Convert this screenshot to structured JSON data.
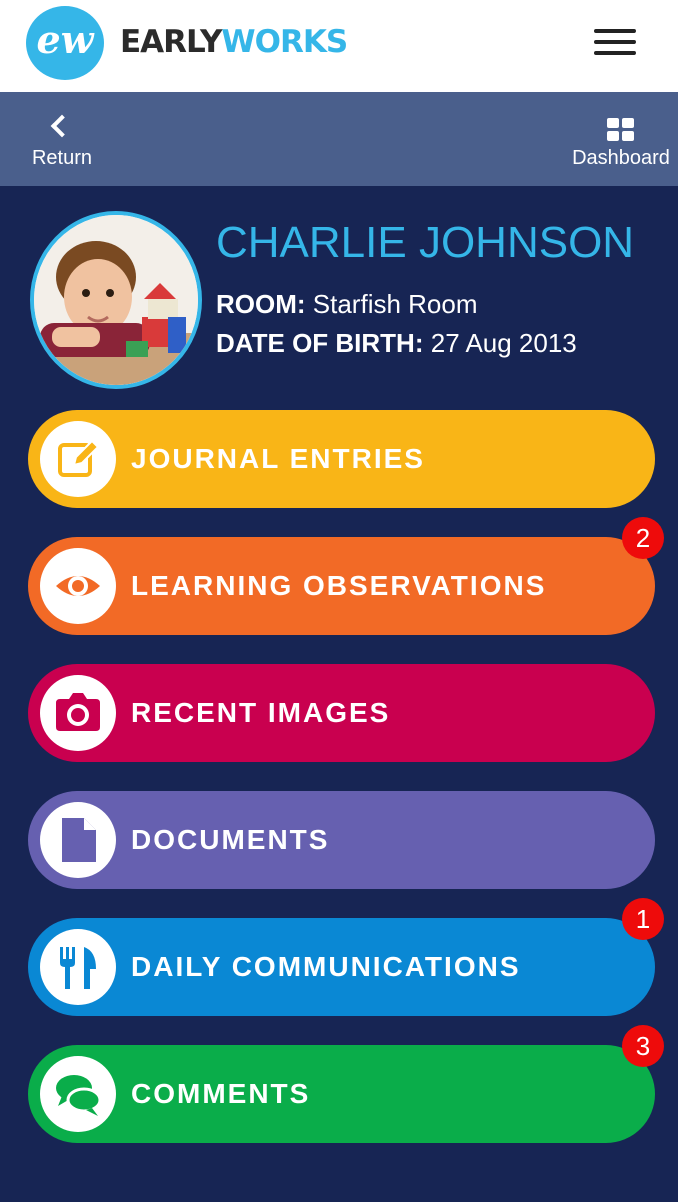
{
  "app": {
    "logo_monogram": "ew",
    "brand_part1": "EARLY",
    "brand_part2": "WORKS"
  },
  "nav": {
    "return_label": "Return",
    "dashboard_label": "Dashboard"
  },
  "child": {
    "name": "CHARLIE JOHNSON",
    "room_key": "ROOM:",
    "room_value": "Starfish Room",
    "dob_key": "DATE OF BIRTH:",
    "dob_value": "27 Aug 2013"
  },
  "menu": [
    {
      "label": "JOURNAL ENTRIES",
      "icon": "edit-icon",
      "color": "#f9b517",
      "badge": ""
    },
    {
      "label": "LEARNING OBSERVATIONS",
      "icon": "eye-icon",
      "color": "#f26a26",
      "badge": "2"
    },
    {
      "label": "RECENT IMAGES",
      "icon": "camera-icon",
      "color": "#c9004f",
      "badge": ""
    },
    {
      "label": "DOCUMENTS",
      "icon": "document-icon",
      "color": "#6660b0",
      "badge": ""
    },
    {
      "label": "DAILY COMMUNICATIONS",
      "icon": "cutlery-icon",
      "color": "#0a88d4",
      "badge": "1"
    },
    {
      "label": "COMMENTS",
      "icon": "chat-icon",
      "color": "#0aad4a",
      "badge": "3"
    }
  ],
  "colors": {
    "accent": "#35b6e8",
    "background": "#172554",
    "subnav": "#4a5f8c",
    "badge": "#ee0b0b"
  }
}
